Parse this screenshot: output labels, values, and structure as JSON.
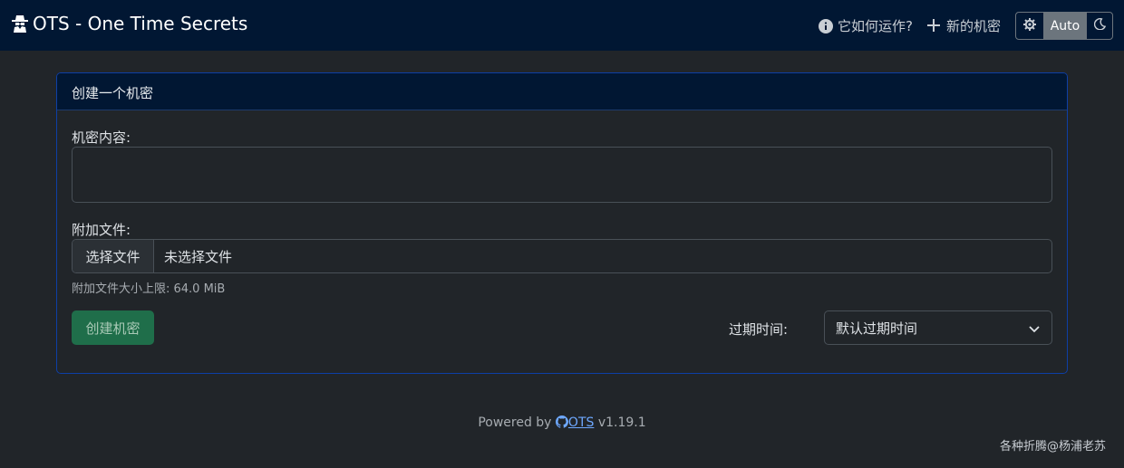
{
  "navbar": {
    "brand": "OTS - One Time Secrets",
    "brand_icon": "spy-icon",
    "how_it_works": "它如何运作?",
    "new_secret": "新的机密",
    "theme": {
      "light_icon": "gear-icon",
      "auto_label": "Auto",
      "dark_icon": "moon-icon"
    }
  },
  "card": {
    "header": "创建一个机密",
    "secret_label": "机密内容:",
    "secret_value": "",
    "attach_label": "附加文件:",
    "file_button": "选择文件",
    "file_none": "未选择文件",
    "file_help": "附加文件大小上限: 64.0 MiB",
    "submit": "创建机密",
    "expiry_label": "过期时间:",
    "expiry_value": "默认过期时间"
  },
  "footer": {
    "powered_by": "Powered by",
    "link": "OTS",
    "version": "v1.19.1"
  },
  "watermark": "各种折腾@杨浦老苏",
  "colors": {
    "navbar_bg": "#011733",
    "page_bg": "#212529",
    "card_border": "#0d3fa6",
    "submit_bg": "#1f6e4a",
    "link": "#6ea8fe"
  }
}
